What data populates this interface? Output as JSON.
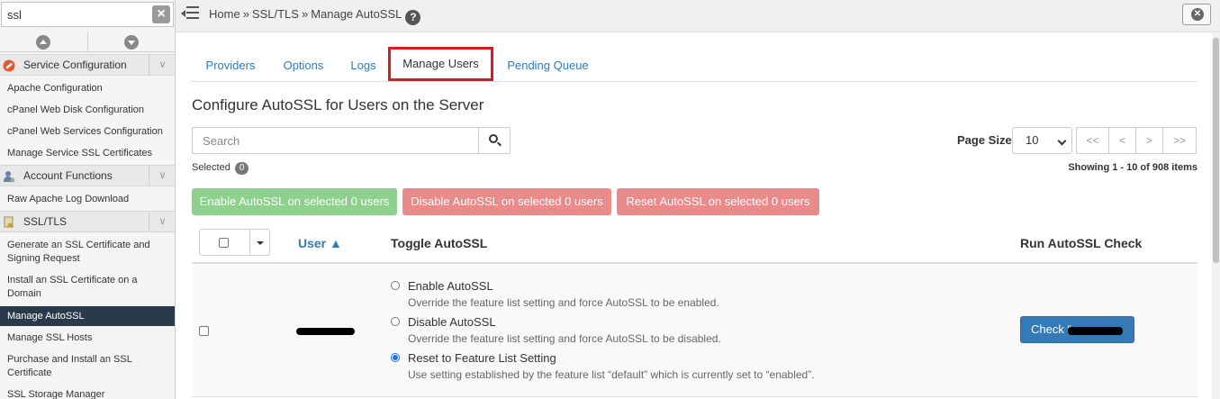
{
  "sidebar": {
    "search_value": "ssl",
    "categories": [
      {
        "label": "Service Configuration",
        "icon": "wrench-icon",
        "items": [
          "Apache Configuration",
          "cPanel Web Disk Configuration",
          "cPanel Web Services Configuration",
          "Manage Service SSL Certificates"
        ]
      },
      {
        "label": "Account Functions",
        "icon": "user-icon",
        "items": [
          "Raw Apache Log Download"
        ]
      },
      {
        "label": "SSL/TLS",
        "icon": "certificate-icon",
        "items": [
          "Generate an SSL Certificate and Signing Request",
          "Install an SSL Certificate on a Domain",
          "Manage AutoSSL",
          "Manage SSL Hosts",
          "Purchase and Install an SSL Certificate",
          "SSL Storage Manager"
        ]
      }
    ]
  },
  "breadcrumb": {
    "home": "Home",
    "sep": "»",
    "section": "SSL/TLS",
    "page": "Manage AutoSSL"
  },
  "tabs": [
    "Providers",
    "Options",
    "Logs",
    "Manage Users",
    "Pending Queue"
  ],
  "active_tab": "Manage Users",
  "main": {
    "title": "Configure AutoSSL for Users on the Server",
    "search_placeholder": "Search",
    "selected_label": "Selected",
    "selected_count": "0",
    "page_size_label": "Page Size",
    "page_size_value": "10",
    "pager": [
      "<<",
      "<",
      ">",
      ">>"
    ],
    "showing": "Showing 1 - 10 of 908 items",
    "actions": {
      "enable": "Enable AutoSSL on selected 0 users",
      "disable": "Disable AutoSSL on selected 0 users",
      "reset": "Reset AutoSSL on selected 0 users"
    },
    "table": {
      "col_user": "User ▲",
      "col_toggle": "Toggle AutoSSL",
      "col_check": "Run AutoSSL Check"
    },
    "row": {
      "options": [
        {
          "label": "Enable AutoSSL",
          "desc": "Override the feature list setting and force AutoSSL to be enabled.",
          "selected": false
        },
        {
          "label": "Disable AutoSSL",
          "desc": "Override the feature list setting and force AutoSSL to be disabled.",
          "selected": false
        },
        {
          "label": "Reset to Feature List Setting",
          "desc": "Use setting established by the feature list “default” which is currently set to “enabled”.",
          "selected": true
        }
      ],
      "check_button": "Check “"
    }
  },
  "colors": {
    "link": "#337ab7",
    "highlight_box": "#e0191f",
    "active_sidebar": "#293a4a",
    "enable_btn": "#8fd08f",
    "disable_btn": "#e98b8a"
  }
}
